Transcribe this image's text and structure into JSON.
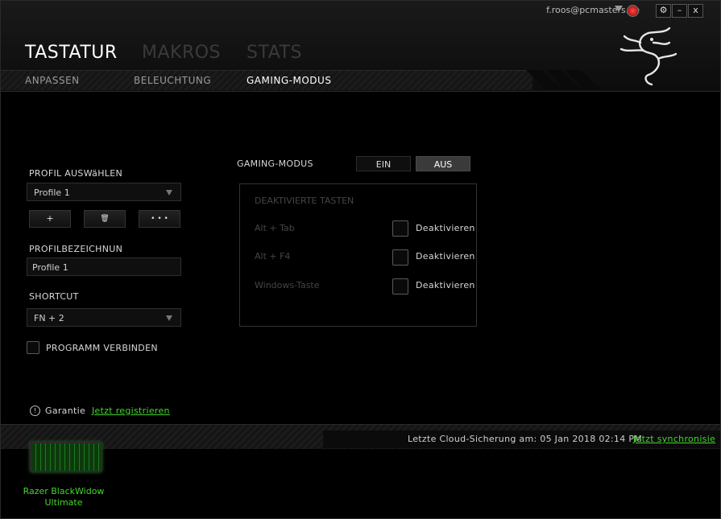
{
  "account": {
    "email": "f.roos@pcmasters.de"
  },
  "window_buttons": {
    "settings": "⚙",
    "minimize": "–",
    "close": "x"
  },
  "main_tabs": [
    {
      "label": "TASTATUR",
      "active": true
    },
    {
      "label": "MAKROS",
      "active": false
    },
    {
      "label": "STATS",
      "active": false
    }
  ],
  "sub_tabs": [
    {
      "label": "ANPASSEN",
      "active": false
    },
    {
      "label": "BELEUCHTUNG",
      "active": false
    },
    {
      "label": "GAMING-MODUS",
      "active": true
    }
  ],
  "profile": {
    "select_label": "PROFIL AUSWäHLEN",
    "selected": "Profile 1",
    "add_label": "+",
    "delete_label": "🗑",
    "more_label": "• • •",
    "name_label": "PROFILBEZEICHNUN",
    "name_value": "Profile 1",
    "shortcut_label": "SHORTCUT",
    "shortcut_value": "FN + 2",
    "link_program_label": "PROGRAMM VERBINDEN"
  },
  "gaming_mode": {
    "label": "GAMING-MODUS",
    "on_label": "EIN",
    "off_label": "AUS",
    "state": "AUS",
    "disabled_keys_title": "DEAKTIVIERTE TASTEN",
    "keys": [
      {
        "name": "Alt + Tab",
        "action": "Deaktivieren"
      },
      {
        "name": "Alt + F4",
        "action": "Deaktivieren"
      },
      {
        "name": "Windows-Taste",
        "action": "Deaktivieren"
      }
    ]
  },
  "warranty": {
    "label": "Garantie",
    "link": "Jetzt registrieren"
  },
  "footer": {
    "backup_text": "Letzte Cloud-Sicherung am: 05 Jan 2018 02:14 PM",
    "sync_link": "Jetzt synchronisie",
    "device_name_line1": "Razer BlackWidow",
    "device_name_line2": "Ultimate"
  },
  "colors": {
    "accent": "#44d62c",
    "background": "#000000"
  }
}
